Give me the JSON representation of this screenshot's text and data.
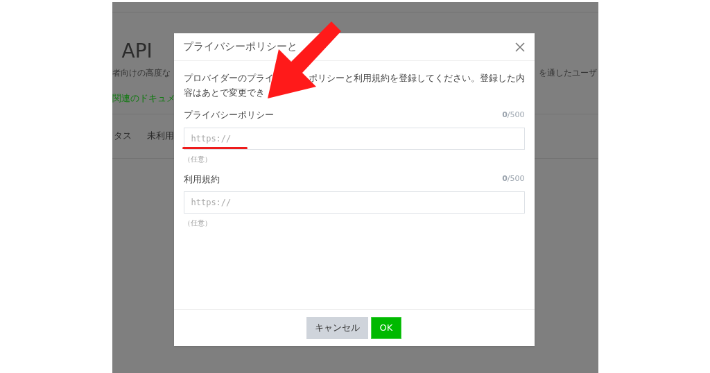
{
  "background_page": {
    "title": "API",
    "subtitle_left": "者向けの高度な",
    "subtitle_right": "を通したユーザ",
    "link": "関連のドキュメ",
    "tabs": [
      {
        "label": "タス"
      },
      {
        "label": "未利用"
      }
    ]
  },
  "dialog": {
    "title": "プライバシーポリシーと",
    "description_parts": [
      "プロバイダーのプライ",
      "ポリシーと利用規約を登録してください。登録した内",
      "容はあとで変更でき"
    ],
    "fields": [
      {
        "label": "プライバシーポリシー",
        "counter": "**0**/500",
        "placeholder": "https://",
        "hint": "（任意）",
        "underlined": true
      },
      {
        "label": "利用規約",
        "counter": "**0**/500",
        "placeholder": "https://",
        "hint": "（任意）",
        "underlined": false
      }
    ],
    "buttons": [
      {
        "label": "キャンセル",
        "kind": "secondary"
      },
      {
        "label": "OK",
        "kind": "primary"
      }
    ]
  }
}
